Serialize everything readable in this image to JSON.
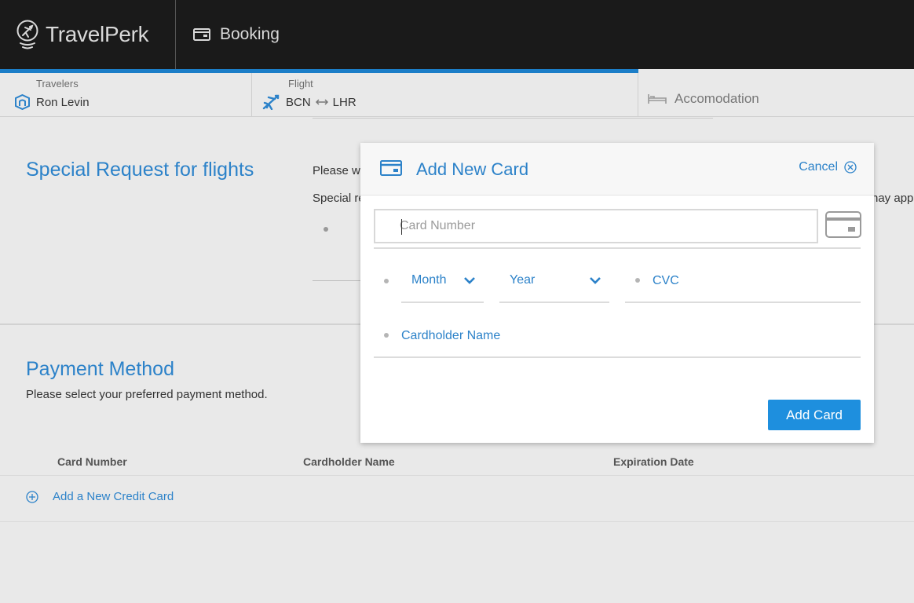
{
  "header": {
    "brand": "TravelPerk",
    "section": "Booking"
  },
  "steps": {
    "travelers": {
      "caption": "Travelers",
      "value": "Ron Levin"
    },
    "flight": {
      "caption": "Flight",
      "from": "BCN",
      "to": "LHR"
    },
    "accommodation": {
      "label": "Accomodation"
    },
    "progress_fraction": 0.7
  },
  "special_request": {
    "title": "Special Request for flights",
    "text1": "Please w",
    "text2": "Special re",
    "text3": "nay app"
  },
  "payment": {
    "title": "Payment Method",
    "subtitle": "Please select your preferred payment method.",
    "columns": [
      "Card Number",
      "Cardholder Name",
      "Expiration Date"
    ],
    "add_link": "Add a New Credit Card"
  },
  "modal": {
    "title": "Add New Card",
    "cancel": "Cancel",
    "card_number_placeholder": "Card Number",
    "month": "Month",
    "year": "Year",
    "cvc": "CVC",
    "cardholder": "Cardholder Name",
    "submit": "Add Card"
  },
  "colors": {
    "accent": "#2c82c9",
    "button": "#1e8fde",
    "topbar": "#1a1a1a",
    "progress": "#1c7ec8"
  }
}
